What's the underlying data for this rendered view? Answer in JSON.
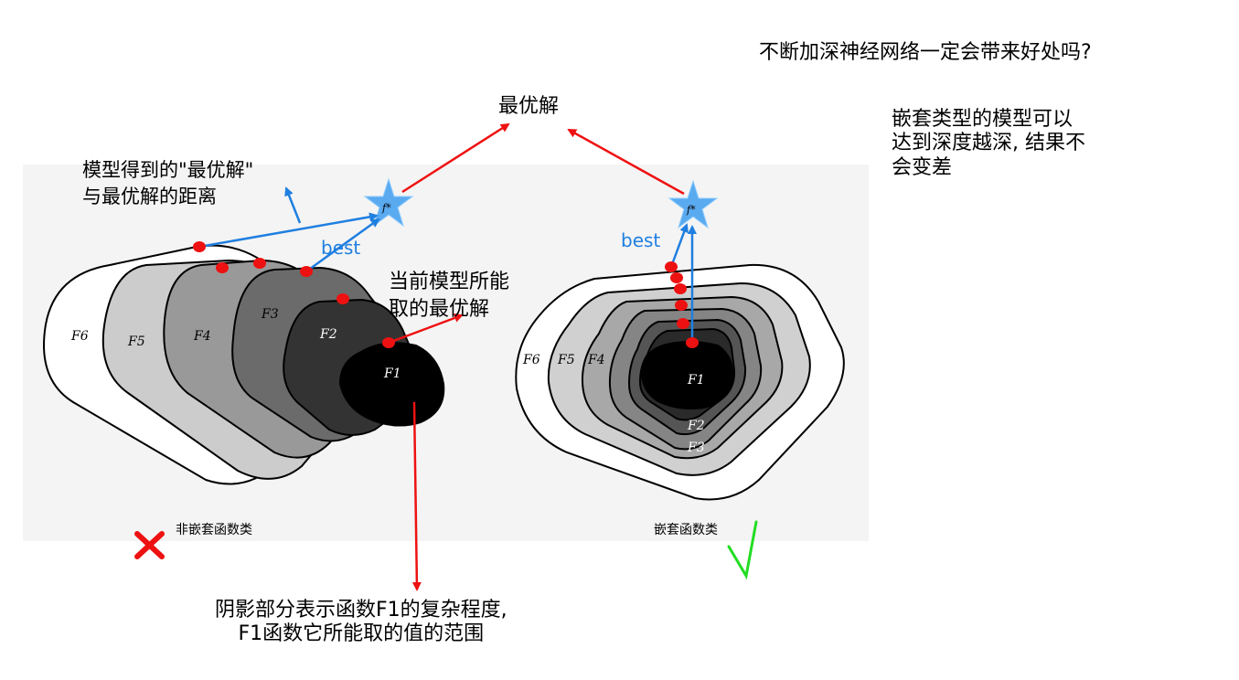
{
  "question": "不断加深神经网络一定会带来好处吗?",
  "nested_note": "嵌套类型的模型可以\n达到深度越深, 结果不\n会变差",
  "optimum_label": "最优解",
  "distance_label": "模型得到的\"最优解\"\n与最优解的距离",
  "current_best_label": "当前模型所能\n取的最优解",
  "best_label": "best",
  "f_star": "f*",
  "left_panel_label": "非嵌套函数类",
  "right_panel_label": "嵌套函数类",
  "caption": "阴影部分表示函数F1的复杂程度,\nF1函数它所能取的值的范围",
  "wrong_mark": "✕",
  "right_mark": "√",
  "left_sets": [
    "F6",
    "F5",
    "F4",
    "F3",
    "F2",
    "F1"
  ],
  "right_sets": [
    "F6",
    "F5",
    "F4",
    "F1",
    "F2",
    "F3"
  ],
  "colors": {
    "arrow_red": "#ee1111",
    "arrow_blue": "#1f7fe0",
    "best_text": "#1f7fe0",
    "star_fill": "#5aaaf0",
    "dot": "#ee1111",
    "cross": "#ee1111",
    "check": "#22dd22"
  }
}
